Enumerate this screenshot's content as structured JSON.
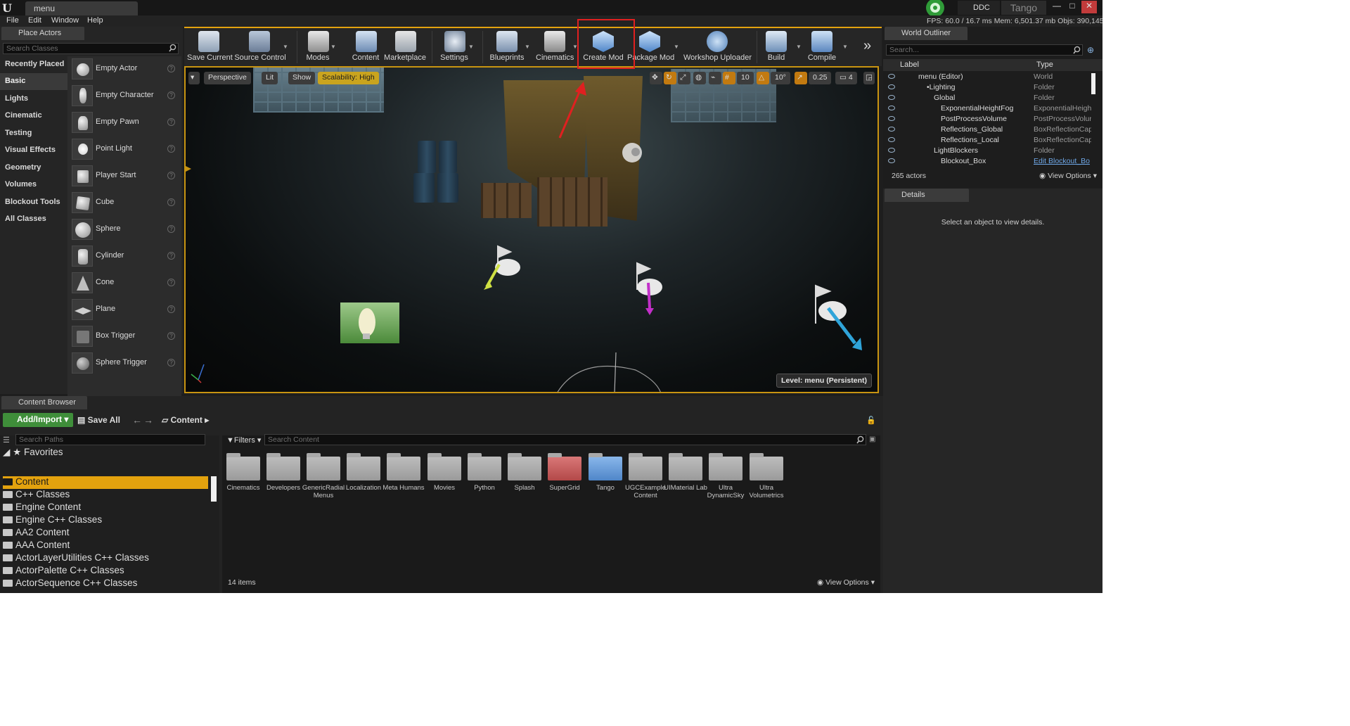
{
  "title_bar": {
    "doc_tab": "menu",
    "ddc": "DDC",
    "project": "Tango",
    "buttons": [
      "—",
      "□",
      "✕"
    ]
  },
  "menu_bar": {
    "items": [
      "File",
      "Edit",
      "Window",
      "Help"
    ]
  },
  "stats": "FPS: 60.0 / 16.7 ms  Mem: 6,501.37 mb  Objs: 390,145",
  "place_actors": {
    "tab": "Place Actors",
    "search_placeholder": "Search Classes",
    "categories": [
      "Recently Placed",
      "Basic",
      "Lights",
      "Cinematic",
      "Testing",
      "Visual Effects",
      "Geometry",
      "Volumes",
      "Blockout Tools",
      "All Classes"
    ],
    "selected_category": "Basic",
    "actors": [
      "Empty Actor",
      "Empty Character",
      "Empty Pawn",
      "Point Light",
      "Player Start",
      "Cube",
      "Sphere",
      "Cylinder",
      "Cone",
      "Plane",
      "Box Trigger",
      "Sphere Trigger"
    ]
  },
  "toolbar": {
    "buttons": [
      "Save Current",
      "Source Control",
      "Modes",
      "Content",
      "Marketplace",
      "Settings",
      "Blueprints",
      "Cinematics",
      "Create Mod",
      "Package Mod",
      "Workshop Uploader",
      "Build",
      "Compile"
    ],
    "highlighted": "Create Mod"
  },
  "viewport": {
    "perspective": "Perspective",
    "lit": "Lit",
    "show": "Show",
    "scalability": "Scalability: High",
    "grid_snap": "10",
    "rotation_snap": "10°",
    "scale_snap": "0.25",
    "camera_speed": "4",
    "level_label": "Level:  menu (Persistent)"
  },
  "outliner": {
    "tab": "World Outliner",
    "search_placeholder": "Search...",
    "col_label": "Label",
    "col_type": "Type",
    "rows": [
      {
        "name": "menu (Editor)",
        "type": "World"
      },
      {
        "name": "•Lighting",
        "type": "Folder"
      },
      {
        "name": "Global",
        "type": "Folder"
      },
      {
        "name": "ExponentialHeightFog",
        "type": "ExponentialHeigh"
      },
      {
        "name": "PostProcessVolume",
        "type": "PostProcessVolur"
      },
      {
        "name": "Reflections_Global",
        "type": "BoxReflectionCap"
      },
      {
        "name": "Reflections_Local",
        "type": "BoxReflectionCap"
      },
      {
        "name": "LightBlockers",
        "type": "Folder"
      },
      {
        "name": "Blockout_Box",
        "type": "Edit Blockout_Bo"
      }
    ],
    "actor_count": "265 actors",
    "view_options": "View Options"
  },
  "details": {
    "tab": "Details",
    "empty_text": "Select an object to view details."
  },
  "content_browser": {
    "tab": "Content Browser",
    "add_import": "Add/Import",
    "save_all": "Save All",
    "path": "Content",
    "search_paths_placeholder": "Search Paths",
    "favorites": "Favorites",
    "filters": "Filters",
    "search_content_placeholder": "Search Content",
    "tree": [
      "Content",
      "C++ Classes",
      "Engine Content",
      "Engine C++ Classes",
      "AA2 Content",
      "AAA Content",
      "ActorLayerUtilities C++ Classes",
      "ActorPalette C++ Classes",
      "ActorSequence C++ Classes"
    ],
    "folders": [
      {
        "name": "Cinematics",
        "color": "#a8a8a8"
      },
      {
        "name": "Developers",
        "color": "#a8a8a8"
      },
      {
        "name": "GenericRadial Menus",
        "color": "#a8a8a8"
      },
      {
        "name": "Localization",
        "color": "#a8a8a8"
      },
      {
        "name": "Meta Humans",
        "color": "#a8a8a8"
      },
      {
        "name": "Movies",
        "color": "#a8a8a8"
      },
      {
        "name": "Python",
        "color": "#a8a8a8"
      },
      {
        "name": "Splash",
        "color": "#a8a8a8"
      },
      {
        "name": "SuperGrid",
        "color": "#c45454"
      },
      {
        "name": "Tango",
        "color": "#5f93cf"
      },
      {
        "name": "UGCExample Content",
        "color": "#a8a8a8"
      },
      {
        "name": "UIMaterial Lab",
        "color": "#a8a8a8"
      },
      {
        "name": "Ultra DynamicSky",
        "color": "#a8a8a8"
      },
      {
        "name": "Ultra Volumetrics",
        "color": "#a8a8a8"
      }
    ],
    "item_count": "14 items",
    "view_options": "View Options"
  }
}
